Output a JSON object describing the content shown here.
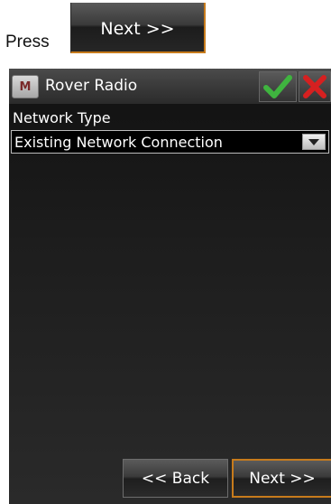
{
  "instruction": {
    "prefix": "Press",
    "button_label": "Next >>"
  },
  "window": {
    "title": "Rover Radio",
    "menu_icon_letter": "M",
    "ok_icon": "green-checkmark-icon",
    "cancel_icon": "red-x-icon"
  },
  "form": {
    "network_type_label": "Network Type",
    "network_type_value": "Existing Network Connection"
  },
  "footer": {
    "back_label": "<< Back",
    "next_label": "Next >>"
  },
  "colors": {
    "accent_border": "#c77b1c",
    "check_green": "#3fb43f",
    "cross_red": "#d62020"
  }
}
